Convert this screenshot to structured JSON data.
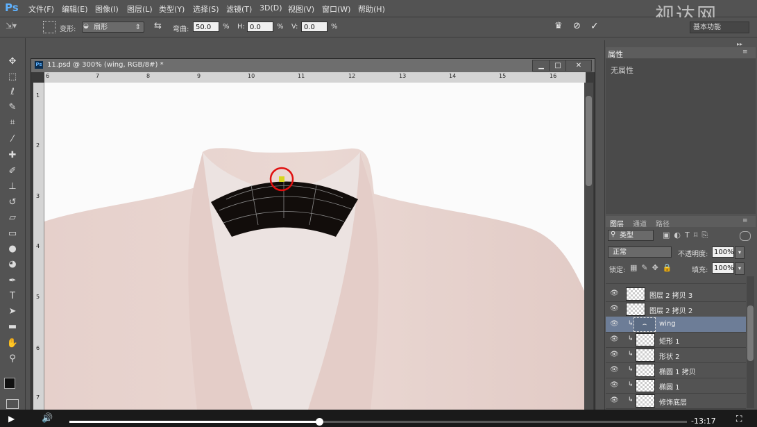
{
  "app": {
    "logo": "Ps",
    "watermark": "视达网"
  },
  "menu": [
    "文件(F)",
    "编辑(E)",
    "图像(I)",
    "图层(L)",
    "类型(Y)",
    "选择(S)",
    "滤镜(T)",
    "3D(D)",
    "视图(V)",
    "窗口(W)",
    "帮助(H)"
  ],
  "options": {
    "warp_label": "变形:",
    "warp_value": "扇形",
    "bend_label": "弯曲:",
    "bend_value": "50.0",
    "bend_unit": "%",
    "h_label": "H:",
    "h_value": "0.0",
    "h_unit": "%",
    "v_label": "V:",
    "v_value": "0.0",
    "v_unit": "%",
    "workspace": "基本功能"
  },
  "document": {
    "title": "11.psd @ 300% (wing, RGB/8#) *",
    "ruler_h": [
      "6",
      "7",
      "8",
      "9",
      "10",
      "11",
      "12",
      "13",
      "14",
      "15",
      "16"
    ],
    "ruler_v": [
      "1",
      "2",
      "3",
      "4",
      "5",
      "6",
      "7"
    ]
  },
  "properties": {
    "tab": "属性",
    "empty": "无属性"
  },
  "layers_panel": {
    "tabs": [
      "图层",
      "通道",
      "路径"
    ],
    "filter_kind": "类型",
    "blend_mode": "正常",
    "opacity_label": "不透明度:",
    "opacity_value": "100%",
    "lock_label": "锁定:",
    "fill_label": "填充:",
    "fill_value": "100%",
    "layers": [
      {
        "name": "图层 2 拷贝 3",
        "clipped": false,
        "selected": false
      },
      {
        "name": "图层 2 拷贝 2",
        "clipped": false,
        "selected": false
      },
      {
        "name": "wing",
        "clipped": true,
        "selected": true
      },
      {
        "name": "矩形 1",
        "clipped": true,
        "selected": false
      },
      {
        "name": "形状 2",
        "clipped": true,
        "selected": false
      },
      {
        "name": "椭圆 1 拷贝",
        "clipped": true,
        "selected": false
      },
      {
        "name": "椭圆 1",
        "clipped": true,
        "selected": false
      },
      {
        "name": "修饰底层",
        "clipped": true,
        "selected": false
      }
    ]
  },
  "player": {
    "time_remaining": "-13:17",
    "progress": 0.405
  }
}
